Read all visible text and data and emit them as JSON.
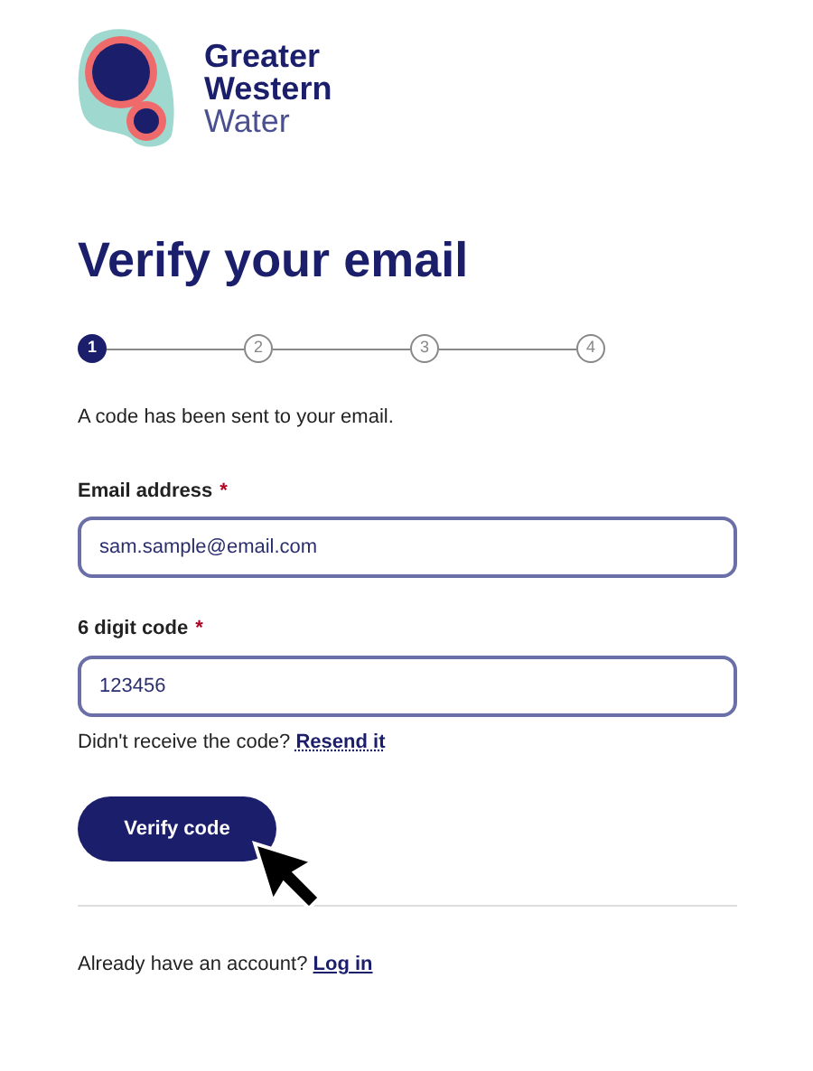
{
  "logo": {
    "line_1": "Greater",
    "line_2": "Western",
    "line_3": "Water"
  },
  "heading": "Verify your email",
  "steps": [
    {
      "label": "1",
      "selected": true
    },
    {
      "label": "2",
      "selected": false
    },
    {
      "label": "3",
      "selected": false
    },
    {
      "label": "4",
      "selected": false
    }
  ],
  "message": "A code has been sent to your email.",
  "fields": [
    {
      "label": "Email address",
      "required_mark": "*",
      "value": "sam.sample@email.com"
    },
    {
      "label": "6 digit code",
      "required_mark": "*",
      "value": "123456"
    }
  ],
  "resend": {
    "text": "Didn't receive the code?",
    "link": "Resend it"
  },
  "button": "Verify code",
  "footer": {
    "text": "Already have an account?",
    "link": "Log in"
  }
}
